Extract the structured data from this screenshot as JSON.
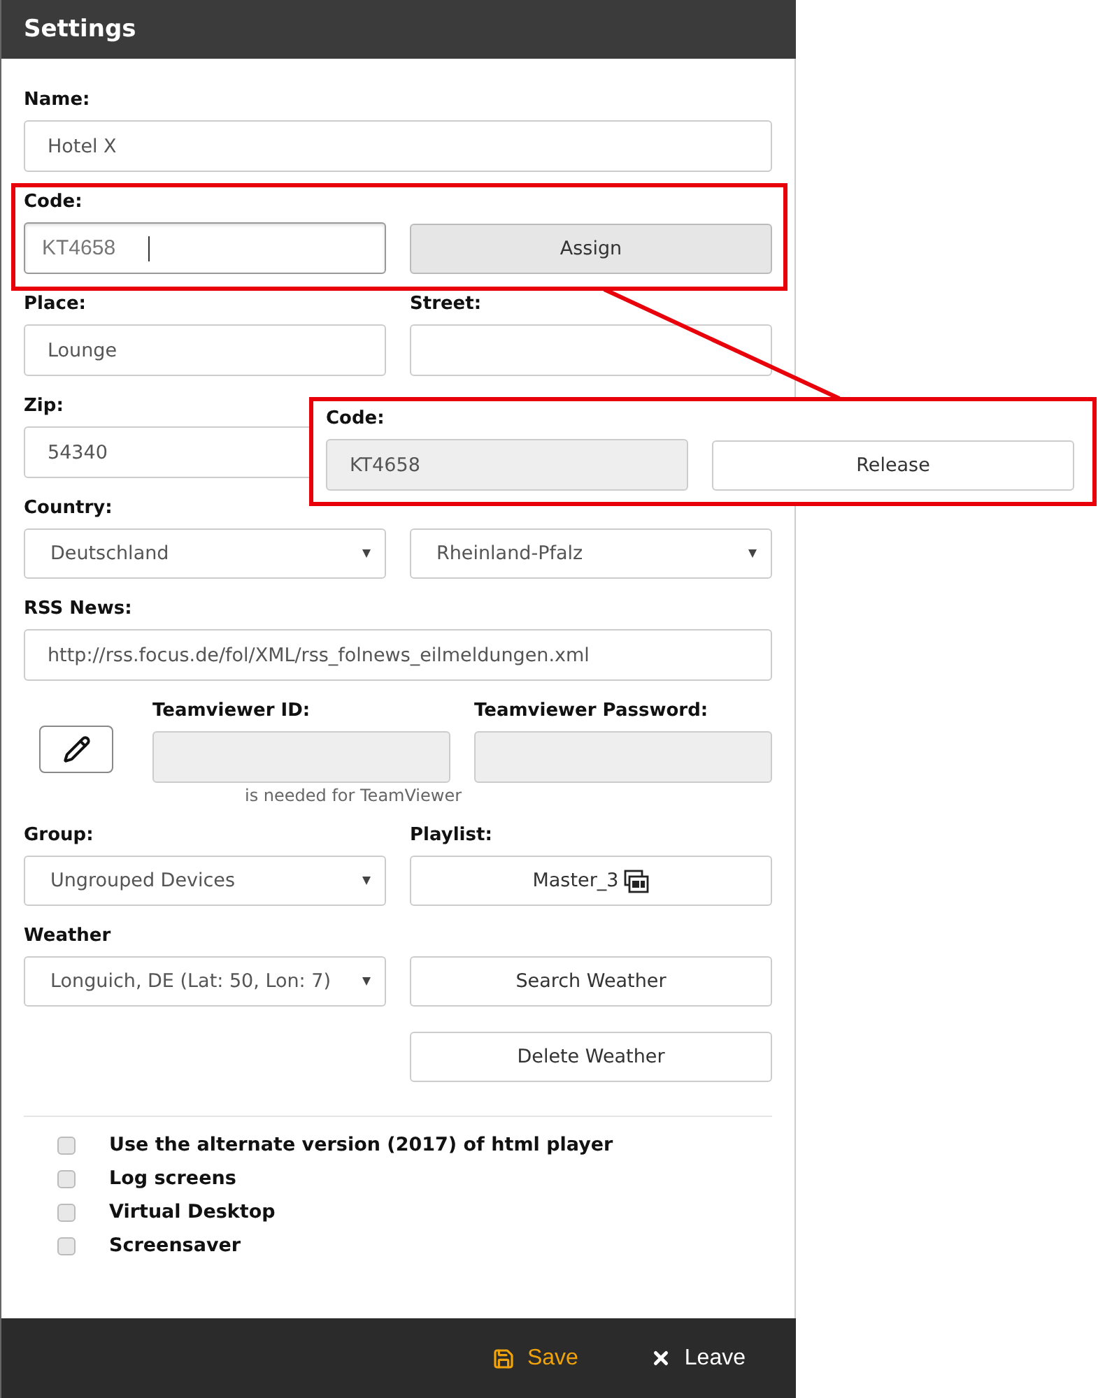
{
  "header": {
    "title": "Settings"
  },
  "name": {
    "label": "Name:",
    "value": "Hotel X",
    "kind": "input"
  },
  "code": {
    "label": "Code:",
    "value": "KT4658",
    "kind": "input",
    "focused": true,
    "button": "Assign"
  },
  "place": {
    "label": "Place:",
    "value": "Lounge",
    "kind": "input"
  },
  "street": {
    "label": "Street:",
    "kind": "input"
  },
  "zip": {
    "label": "Zip:",
    "value": "54340",
    "kind": "input"
  },
  "country": {
    "label": "Country:",
    "value": "Deutschland",
    "kind": "select"
  },
  "county": {
    "value": "Rheinland-Pfalz",
    "kind": "select"
  },
  "rss": {
    "label": "RSS News:",
    "value": "http://rss.focus.de/fol/XML/rss_folnews_eilmeldungen.xml",
    "kind": "input"
  },
  "teamviewer": {
    "id_label": "Teamviewer ID:",
    "password_label": "Teamviewer Password:",
    "hint": "is needed for TeamViewer"
  },
  "group": {
    "label": "Group:",
    "value": "Ungrouped Devices",
    "kind": "select"
  },
  "playlist": {
    "label": "Playlist:",
    "button": "Master_3"
  },
  "weather": {
    "label": "Weather",
    "value": "Longuich, DE (Lat: 50, Lon: 7)",
    "kind": "select",
    "search_button": "Search Weather",
    "delete_button": "Delete Weather"
  },
  "options": [
    {
      "label": "Use the alternate version (2017) of html player",
      "checked": false
    },
    {
      "label": "Log screens",
      "checked": false
    },
    {
      "label": "Virtual Desktop",
      "checked": false
    },
    {
      "label": "Screensaver",
      "checked": false
    }
  ],
  "footer": {
    "save": "Save",
    "leave": "Leave"
  },
  "callout": {
    "label": "Code:",
    "value": "KT4658",
    "kind": "readonly",
    "button": "Release"
  }
}
